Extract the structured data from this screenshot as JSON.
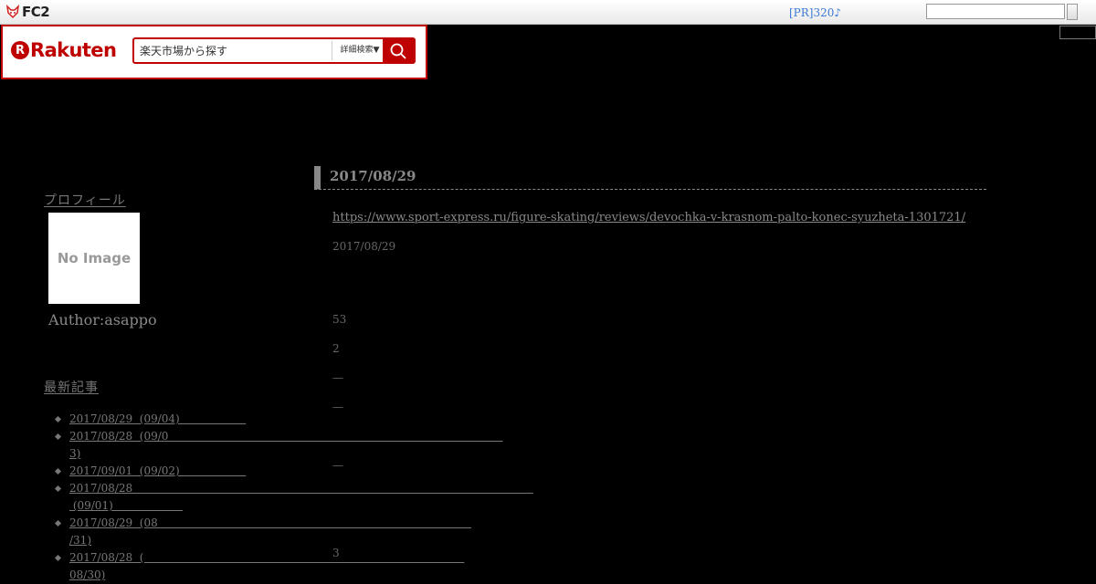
{
  "fc2bar": {
    "logo_text": "FC2",
    "pr_link": "[PR]320♪"
  },
  "rakuten": {
    "logo_word": "Rakuten",
    "search_placeholder": "楽天市場から探す",
    "detail_label": "詳細検索▼"
  },
  "sidebar": {
    "profile_title": "プロフィール",
    "no_image_text": "No Image",
    "author": "Author:asappo",
    "recent_title": "最新記事",
    "recent_items": [
      "2017/08/29  (09/04)                   ",
      "2017/08/28  (09/0                                                                                                \n3)",
      "2017/09/01  (09/02)                   ",
      "2017/08/28                                                                                                                   \n (09/01)                    ",
      "2017/08/29  (08                                                                                          \n/31)",
      "2017/08/28  (                                                                                            \n08/30)"
    ]
  },
  "entry": {
    "date_heading": "2017/08/29",
    "link_text": "https://www.sport-express.ru/figure-skating/reviews/devochka-v-krasnom-palto-konec-syuzheta-1301721/",
    "posted_date": "2017/08/29",
    "stats": [
      "53",
      "2",
      "—",
      "—",
      "—",
      "3"
    ]
  }
}
